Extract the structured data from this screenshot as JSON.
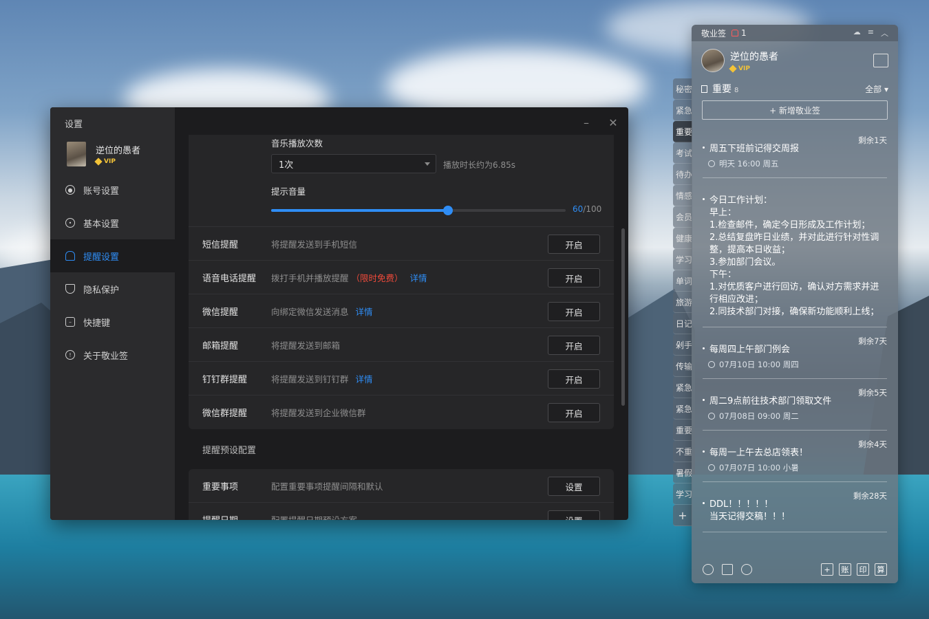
{
  "settings": {
    "title": "设置",
    "user": {
      "name": "逆位的愚者",
      "vip": "VIP"
    },
    "nav": [
      {
        "label": "账号设置",
        "icon": "user-icon"
      },
      {
        "label": "基本设置",
        "icon": "gear-icon"
      },
      {
        "label": "提醒设置",
        "icon": "bell-icon",
        "active": true
      },
      {
        "label": "隐私保护",
        "icon": "shield-icon"
      },
      {
        "label": "快捷键",
        "icon": "keyboard-icon"
      },
      {
        "label": "关于敬业签",
        "icon": "info-icon"
      }
    ],
    "music": {
      "play_count_label": "音乐播放次数",
      "play_count_value": "1次",
      "duration_hint": "播放时长约为6.85s",
      "volume_label": "提示音量",
      "volume_value": "60",
      "volume_max": "/100",
      "volume_fraction": 0.6
    },
    "reminders": [
      {
        "title": "短信提醒",
        "desc": "将提醒发送到手机短信",
        "button": "开启"
      },
      {
        "title": "语音电话提醒",
        "desc": "拨打手机并播放提醒",
        "free": "（限时免费）",
        "link": "详情",
        "button": "开启"
      },
      {
        "title": "微信提醒",
        "desc": "向绑定微信发送消息",
        "link": "详情",
        "button": "开启"
      },
      {
        "title": "邮箱提醒",
        "desc": "将提醒发送到邮箱",
        "button": "开启"
      },
      {
        "title": "钉钉群提醒",
        "desc": "将提醒发送到钉钉群",
        "link": "详情",
        "button": "开启"
      },
      {
        "title": "微信群提醒",
        "desc": "将提醒发送到企业微信群",
        "button": "开启"
      }
    ],
    "preset_section": "提醒预设配置",
    "presets": [
      {
        "title": "重要事项",
        "desc": "配置重要事项提醒间隔和默认",
        "button": "设置"
      },
      {
        "title": "提醒日期",
        "desc": "配置提醒日期预设方案",
        "button": "设置"
      }
    ]
  },
  "widget": {
    "app_name": "敬业签",
    "notify_count": "1",
    "user": {
      "name": "逆位的愚者",
      "vip": "VIP"
    },
    "list_title": "重要",
    "list_count": "8",
    "filter": "全部",
    "add_label": "+ 新增敬业签",
    "notes": [
      {
        "remain": "剩余1天",
        "text": "周五下班前记得交周报",
        "meta": "明天 16:00 周五"
      },
      {
        "remain": "",
        "text": "今日工作计划：\n早上：\n1.检查邮件，确定今日形成及工作计划；\n2.总结复盘昨日业绩，并对此进行针对性调整，提高本日收益；\n3.参加部门会议。\n下午：\n1.对优质客户进行回访，确认对方需求并进行相应改进；\n2.同技术部门对接，确保新功能顺利上线；",
        "meta": ""
      },
      {
        "remain": "剩余7天",
        "text": "每周四上午部门例会",
        "meta": "07月10日 10:00 周四"
      },
      {
        "remain": "剩余5天",
        "text": "周二9点前往技术部门领取文件",
        "meta": "07月08日 09:00 周二"
      },
      {
        "remain": "剩余4天",
        "text": "每周一上午去总店领表！",
        "meta": "07月07日 10:00 小暑"
      },
      {
        "remain": "剩余28天",
        "text": "DDL！！！！！\n当天记得交稿！！！",
        "meta": ""
      }
    ],
    "footer_keys": [
      "+",
      "账",
      "印",
      "算"
    ],
    "tabs": [
      "秘密",
      "紧急",
      "重要",
      "考试",
      "待办",
      "情感",
      "会员",
      "健康",
      "学习",
      "单词",
      "旅游",
      "日记",
      "剁手",
      "传输",
      "紧急",
      "紧急",
      "重要",
      "不重",
      "暑假",
      "学习"
    ],
    "active_tab": 2
  }
}
